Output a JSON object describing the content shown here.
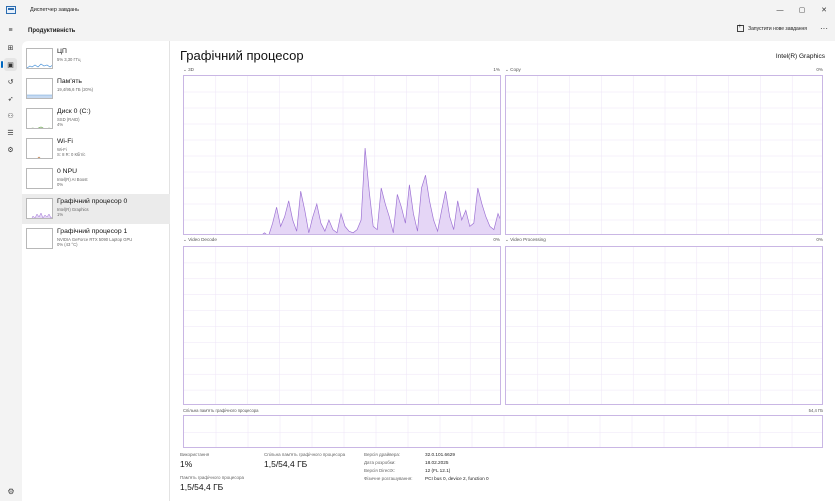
{
  "window": {
    "title": "Диспетчер завдань",
    "minimize": "—",
    "maximize": "▢",
    "close": "✕"
  },
  "header": {
    "title": "Продуктивність",
    "run_task": "Запустити нове завдання",
    "more": "···"
  },
  "nav": [
    {
      "name": "hamburger-menu-icon",
      "glyph": "≡"
    },
    {
      "name": "processes-icon",
      "glyph": "⊞"
    },
    {
      "name": "performance-icon",
      "glyph": "▣"
    },
    {
      "name": "app-history-icon",
      "glyph": "↺"
    },
    {
      "name": "startup-apps-icon",
      "glyph": "➶"
    },
    {
      "name": "users-icon",
      "glyph": "⚇"
    },
    {
      "name": "details-icon",
      "glyph": "☰"
    },
    {
      "name": "services-icon",
      "glyph": "⚙"
    }
  ],
  "settings_glyph": "⚙",
  "sidebar": [
    {
      "name": "ЦП",
      "sub1": "5% 3,30 ГГц",
      "sub2": ""
    },
    {
      "name": "Пам'ять",
      "sub1": "19,4/95,6 ГБ (20%)",
      "sub2": ""
    },
    {
      "name": "Диск 0 (C:)",
      "sub1": "SSD (RAID)",
      "sub2": "4%"
    },
    {
      "name": "Wi-Fi",
      "sub1": "Wi-Fi",
      "sub2": "S: 8 R: 0 Кбіт/с"
    },
    {
      "name": "0 NPU",
      "sub1": "Intel(R) AI Boost",
      "sub2": "0%"
    },
    {
      "name": "Графічний процесор 0",
      "sub1": "Intel(R) Graphics",
      "sub2": "1%"
    },
    {
      "name": "Графічний процесор 1",
      "sub1": "NVIDIA GeForce RTX 5090 Laptop GPU",
      "sub2": "0% (43 °C)"
    }
  ],
  "main": {
    "title": "Графічний процесор",
    "gpu_name": "Intel(R) Graphics",
    "panels": [
      {
        "label": "⌄ 3D",
        "pct": "1%"
      },
      {
        "label": "⌄ Copy",
        "pct": "0%"
      },
      {
        "label": "⌄ Video Decode",
        "pct": "0%"
      },
      {
        "label": "⌄ Video Processing",
        "pct": "0%"
      }
    ],
    "shared_memory": {
      "label": "Спільна пам'ять графічного процесора",
      "value": "54,4 ГБ"
    },
    "stats": {
      "usage_label": "Використання",
      "usage_value": "1%",
      "shared_label": "Спільна пам'ять графічного процесора",
      "shared_value": "1,5/54,4 ГБ",
      "gpu_mem_label": "Пам'ять графічного процесора",
      "gpu_mem_value": "1,5/54,4 ГБ"
    },
    "info": [
      {
        "label": "Версія драйвера:",
        "value": "32.0.101.6629"
      },
      {
        "label": "Дата розробки:",
        "value": "18.02.2025"
      },
      {
        "label": "Версія DirectX:",
        "value": "12 (FL 12.1)"
      },
      {
        "label": "Фізичне розташування:",
        "value": "PCI bus 0, device 2, function 0"
      }
    ]
  },
  "colors": {
    "accent": "#0067c0",
    "graph_border": "#c9b6e4",
    "graph_fill": "#e5d6f6",
    "graph_line": "#9e73d4"
  },
  "chart_data": {
    "type": "area",
    "title": "3D",
    "ylim": [
      0,
      100
    ],
    "series": [
      {
        "values": [
          0,
          0,
          0,
          0,
          0,
          0,
          0,
          0,
          0,
          0,
          0,
          0,
          0,
          0,
          0,
          0,
          0,
          0,
          0,
          0,
          2,
          0,
          8,
          18,
          6,
          12,
          22,
          10,
          3,
          28,
          16,
          2,
          12,
          20,
          8,
          3,
          10,
          4,
          2,
          14,
          6,
          3,
          2,
          4,
          10,
          55,
          28,
          6,
          4,
          30,
          20,
          12,
          2,
          26,
          18,
          8,
          32,
          14,
          3,
          30,
          38,
          22,
          10,
          3,
          16,
          28,
          12,
          4,
          22,
          10,
          16,
          6,
          8,
          30,
          20,
          12,
          6,
          4,
          14,
          8
        ]
      }
    ]
  }
}
